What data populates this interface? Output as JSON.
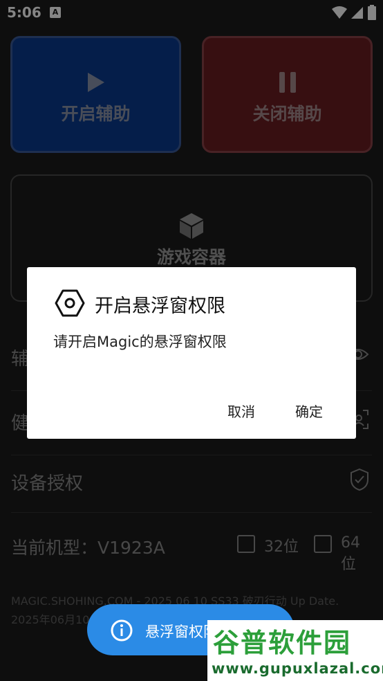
{
  "status_bar": {
    "time": "5:06",
    "notification_letter": "A"
  },
  "cards": {
    "start": {
      "label": "开启辅助",
      "color": "#0a3a8e"
    },
    "stop": {
      "label": "关闭辅助",
      "color": "#6a1d22"
    },
    "game_container": {
      "label": "游戏容器"
    }
  },
  "rows": [
    {
      "label": "辅",
      "icon": "eye-icon"
    },
    {
      "label": "健",
      "icon": "face-scan-icon"
    },
    {
      "label": "设备授权",
      "icon": "shield-check-icon"
    }
  ],
  "device": {
    "label": "当前机型：V1923A",
    "option_32": "32位",
    "option_64": "64位"
  },
  "footer": {
    "line1": "MAGIC.SHOHING.COM - 2025 06 10 SS33 破刃行动 Up Date.",
    "line2": "2025年06月10                                    更新."
  },
  "dialog": {
    "title": "开启悬浮窗权限",
    "message": "请开启Magic的悬浮窗权限",
    "cancel_label": "取消",
    "confirm_label": "确定"
  },
  "toast": {
    "text": "悬浮窗权限未开启"
  },
  "watermark": {
    "brand": "谷普软件园",
    "url": "www.gupuxlazal.com"
  }
}
